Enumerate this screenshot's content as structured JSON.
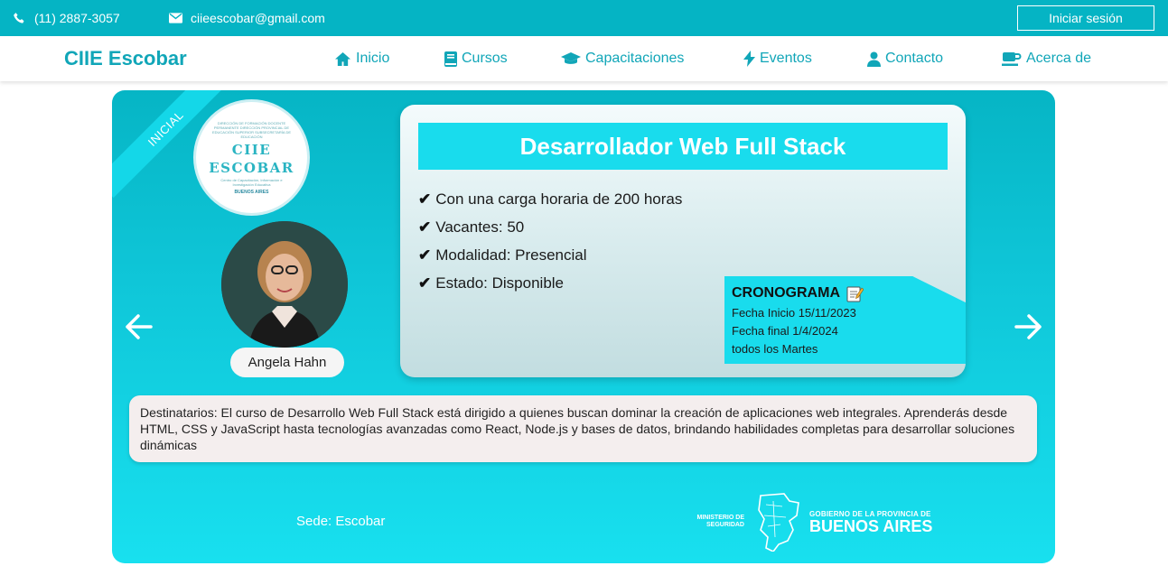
{
  "topbar": {
    "phone": "(11) 2887-3057",
    "email": "ciieescobar@gmail.com",
    "login_label": "Iniciar sesión"
  },
  "nav": {
    "brand": "CIIE Escobar",
    "items": [
      {
        "label": "Inicio",
        "icon": "home-icon"
      },
      {
        "label": "Cursos",
        "icon": "book-icon"
      },
      {
        "label": "Capacitaciones",
        "icon": "graduation-cap-icon"
      },
      {
        "label": "Eventos",
        "icon": "bolt-icon"
      },
      {
        "label": "Contacto",
        "icon": "user-icon"
      },
      {
        "label": "Acerca de",
        "icon": "coffee-icon"
      }
    ]
  },
  "course": {
    "ribbon": "INICIAL",
    "logo": {
      "small_text": "DIRECCIÓN DE FORMACIÓN DOCENTE PERMANENTE DIRECCIÓN PROVINCIAL DE EDUCACIÓN SUPERIOR SUBSECRETARÍA DE EDUCACIÓN",
      "title_line1": "CIIE",
      "title_line2": "ESCOBAR",
      "subtitle": "Centro de Capacitación, Información e Investigación Educativa",
      "ba": "BUENOS AIRES"
    },
    "teacher": "Angela Hahn",
    "title": "Desarrollador Web Full Stack",
    "features": [
      "Con una carga horaria de 200 horas",
      "Vacantes: 50",
      "Modalidad: Presencial",
      "Estado: Disponible"
    ],
    "check_glyph": "✔",
    "schedule": {
      "title": "CRONOGRAMA",
      "start": "Fecha Inicio 15/11/2023",
      "end": "Fecha final 1/4/2024",
      "days": "todos los Martes"
    },
    "recipients": "Destinatarios: El curso de Desarrollo Web Full Stack está dirigido a quienes buscan dominar la creación de aplicaciones web integrales. Aprenderás desde HTML, CSS y JavaScript hasta tecnologías avanzadas como React, Node.js y bases de datos, brindando habilidades completas para desarrollar soluciones dinámicas",
    "sede": "Sede: Escobar"
  },
  "footer_logo": {
    "ministry": "MINISTERIO DE SEGURIDAD",
    "gov_line": "GOBIERNO DE LA PROVINCIA DE",
    "province": "BUENOS AIRES"
  },
  "colors": {
    "primary": "#05b4c4",
    "accent": "#19dced",
    "brand_text": "#11a6b8"
  }
}
